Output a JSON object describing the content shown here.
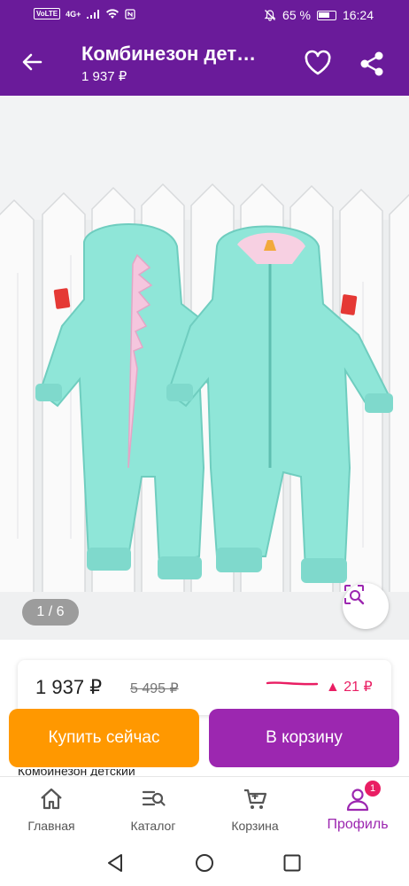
{
  "status_bar": {
    "network_badge": "VoLTE",
    "network_type": "4G+",
    "battery": "65 %",
    "time": "16:24"
  },
  "app_bar": {
    "title": "Комбинезон дет…",
    "price": "1 937 ₽"
  },
  "gallery": {
    "counter": "1 / 6"
  },
  "price_card": {
    "current": "1 937 ₽",
    "old": "5 495 ₽",
    "change": "▲ 21 ₽"
  },
  "actions": {
    "buy_now": "Купить сейчас",
    "add_to_cart": "В корзину"
  },
  "description_peek": "Комбинезон детский",
  "bottom_nav": [
    {
      "label": "Главная",
      "icon": "home-icon"
    },
    {
      "label": "Каталог",
      "icon": "catalog-search-icon"
    },
    {
      "label": "Корзина",
      "icon": "cart-icon"
    },
    {
      "label": "Профиль",
      "icon": "profile-icon",
      "badge": "1",
      "active": true
    }
  ],
  "colors": {
    "brand": "#6a1b9a",
    "accent": "#9c27b0",
    "buy": "#ff9800",
    "price_up": "#e91e63"
  }
}
